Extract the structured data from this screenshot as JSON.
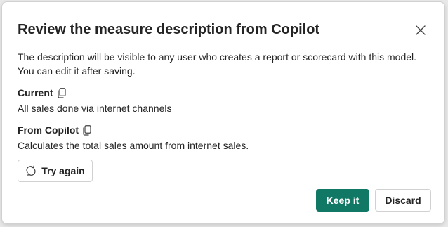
{
  "dialog": {
    "title": "Review the measure description from Copilot",
    "description": "The description will be visible to any user who creates a report or scorecard with this model. You can edit it after saving.",
    "current": {
      "label": "Current",
      "text": "All sales done via internet channels",
      "icon": "copy-icon"
    },
    "copilot": {
      "label": "From Copilot",
      "text": "Calculates the total sales amount from internet sales.",
      "icon": "copy-icon"
    },
    "try_again_label": "Try again",
    "keep_label": "Keep it",
    "discard_label": "Discard",
    "close_icon": "close-icon",
    "colors": {
      "primary": "#117865",
      "text": "#242424",
      "border": "#d1d1d1"
    }
  }
}
